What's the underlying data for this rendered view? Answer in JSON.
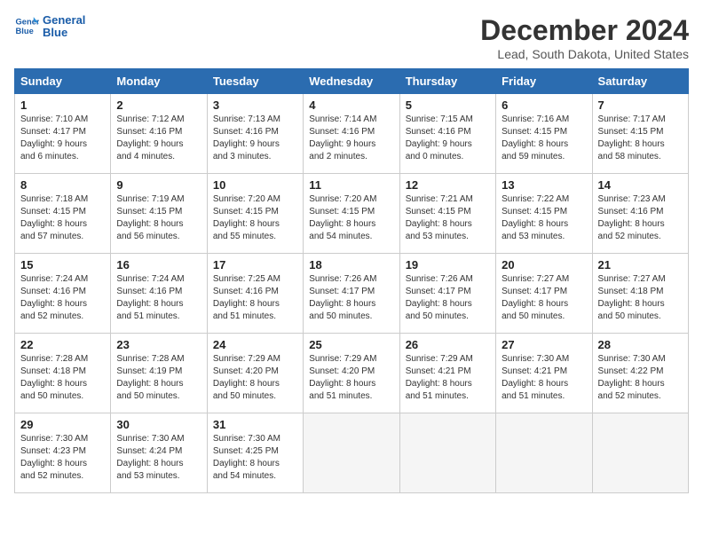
{
  "logo": {
    "line1": "General",
    "line2": "Blue"
  },
  "title": "December 2024",
  "subtitle": "Lead, South Dakota, United States",
  "days_of_week": [
    "Sunday",
    "Monday",
    "Tuesday",
    "Wednesday",
    "Thursday",
    "Friday",
    "Saturday"
  ],
  "weeks": [
    [
      {
        "day": 1,
        "rise": "7:10 AM",
        "set": "4:17 PM",
        "daylight": "9 hours and 6 minutes."
      },
      {
        "day": 2,
        "rise": "7:12 AM",
        "set": "4:16 PM",
        "daylight": "9 hours and 4 minutes."
      },
      {
        "day": 3,
        "rise": "7:13 AM",
        "set": "4:16 PM",
        "daylight": "9 hours and 3 minutes."
      },
      {
        "day": 4,
        "rise": "7:14 AM",
        "set": "4:16 PM",
        "daylight": "9 hours and 2 minutes."
      },
      {
        "day": 5,
        "rise": "7:15 AM",
        "set": "4:16 PM",
        "daylight": "9 hours and 0 minutes."
      },
      {
        "day": 6,
        "rise": "7:16 AM",
        "set": "4:15 PM",
        "daylight": "8 hours and 59 minutes."
      },
      {
        "day": 7,
        "rise": "7:17 AM",
        "set": "4:15 PM",
        "daylight": "8 hours and 58 minutes."
      }
    ],
    [
      {
        "day": 8,
        "rise": "7:18 AM",
        "set": "4:15 PM",
        "daylight": "8 hours and 57 minutes."
      },
      {
        "day": 9,
        "rise": "7:19 AM",
        "set": "4:15 PM",
        "daylight": "8 hours and 56 minutes."
      },
      {
        "day": 10,
        "rise": "7:20 AM",
        "set": "4:15 PM",
        "daylight": "8 hours and 55 minutes."
      },
      {
        "day": 11,
        "rise": "7:20 AM",
        "set": "4:15 PM",
        "daylight": "8 hours and 54 minutes."
      },
      {
        "day": 12,
        "rise": "7:21 AM",
        "set": "4:15 PM",
        "daylight": "8 hours and 53 minutes."
      },
      {
        "day": 13,
        "rise": "7:22 AM",
        "set": "4:15 PM",
        "daylight": "8 hours and 53 minutes."
      },
      {
        "day": 14,
        "rise": "7:23 AM",
        "set": "4:16 PM",
        "daylight": "8 hours and 52 minutes."
      }
    ],
    [
      {
        "day": 15,
        "rise": "7:24 AM",
        "set": "4:16 PM",
        "daylight": "8 hours and 52 minutes."
      },
      {
        "day": 16,
        "rise": "7:24 AM",
        "set": "4:16 PM",
        "daylight": "8 hours and 51 minutes."
      },
      {
        "day": 17,
        "rise": "7:25 AM",
        "set": "4:16 PM",
        "daylight": "8 hours and 51 minutes."
      },
      {
        "day": 18,
        "rise": "7:26 AM",
        "set": "4:17 PM",
        "daylight": "8 hours and 50 minutes."
      },
      {
        "day": 19,
        "rise": "7:26 AM",
        "set": "4:17 PM",
        "daylight": "8 hours and 50 minutes."
      },
      {
        "day": 20,
        "rise": "7:27 AM",
        "set": "4:17 PM",
        "daylight": "8 hours and 50 minutes."
      },
      {
        "day": 21,
        "rise": "7:27 AM",
        "set": "4:18 PM",
        "daylight": "8 hours and 50 minutes."
      }
    ],
    [
      {
        "day": 22,
        "rise": "7:28 AM",
        "set": "4:18 PM",
        "daylight": "8 hours and 50 minutes."
      },
      {
        "day": 23,
        "rise": "7:28 AM",
        "set": "4:19 PM",
        "daylight": "8 hours and 50 minutes."
      },
      {
        "day": 24,
        "rise": "7:29 AM",
        "set": "4:20 PM",
        "daylight": "8 hours and 50 minutes."
      },
      {
        "day": 25,
        "rise": "7:29 AM",
        "set": "4:20 PM",
        "daylight": "8 hours and 51 minutes."
      },
      {
        "day": 26,
        "rise": "7:29 AM",
        "set": "4:21 PM",
        "daylight": "8 hours and 51 minutes."
      },
      {
        "day": 27,
        "rise": "7:30 AM",
        "set": "4:21 PM",
        "daylight": "8 hours and 51 minutes."
      },
      {
        "day": 28,
        "rise": "7:30 AM",
        "set": "4:22 PM",
        "daylight": "8 hours and 52 minutes."
      }
    ],
    [
      {
        "day": 29,
        "rise": "7:30 AM",
        "set": "4:23 PM",
        "daylight": "8 hours and 52 minutes."
      },
      {
        "day": 30,
        "rise": "7:30 AM",
        "set": "4:24 PM",
        "daylight": "8 hours and 53 minutes."
      },
      {
        "day": 31,
        "rise": "7:30 AM",
        "set": "4:25 PM",
        "daylight": "8 hours and 54 minutes."
      },
      null,
      null,
      null,
      null
    ]
  ],
  "labels": {
    "sunrise": "Sunrise:",
    "sunset": "Sunset:",
    "daylight": "Daylight:"
  }
}
